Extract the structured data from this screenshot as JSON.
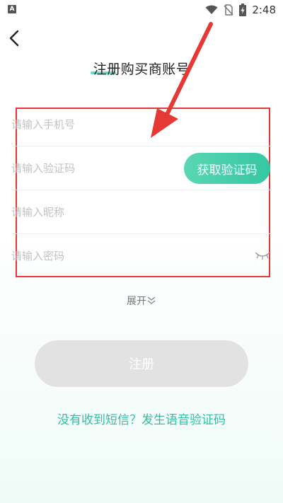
{
  "status_bar": {
    "app_icon_letter": "A",
    "time": "2:48",
    "icons": [
      "wifi-icon",
      "no-sim-icon",
      "battery-charging-icon"
    ]
  },
  "header": {
    "back_icon": "chevron-left-icon",
    "title": "注册购买商账号"
  },
  "form": {
    "phone_placeholder": "请输入手机号",
    "code_placeholder": "请输入验证码",
    "get_code_label": "获取验证码",
    "nickname_placeholder": "请输入昵称",
    "password_placeholder": "请输入密码",
    "password_toggle_icon": "eye-closed-icon"
  },
  "expand": {
    "label": "展开",
    "icon": "double-chevron-down-icon"
  },
  "submit_label": "注册",
  "voice_code_link": "没有收到短信？发生语音验证码",
  "colors": {
    "accent": "#35c7a3",
    "link": "#33bfa0",
    "highlight_box": "#e53935",
    "disabled_button": "#e2e2e2"
  }
}
